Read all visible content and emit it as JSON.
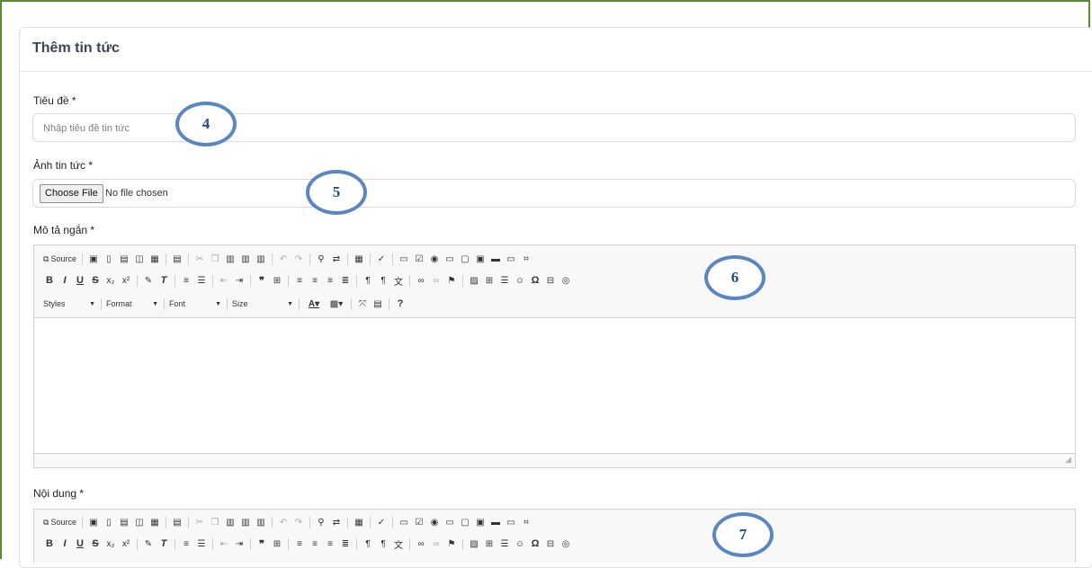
{
  "page": {
    "title": "Thêm tin tức"
  },
  "fields": {
    "title_label": "Tiêu đề *",
    "title_placeholder": "Nhập tiêu đề tin tức",
    "image_label": "Ảnh tin tức *",
    "choose_file_button": "Choose File",
    "no_file_text": "No file chosen",
    "short_desc_label": "Mô tả ngắn *",
    "content_label": "Nội dung *"
  },
  "toolbar": {
    "source": "Source",
    "styles": "Styles",
    "format": "Format",
    "font": "Font",
    "size": "Size",
    "help": "?"
  },
  "callouts": {
    "c4": "4",
    "c5": "5",
    "c6": "6",
    "c7": "7"
  },
  "colors": {
    "frame_border": "#5b8a3a",
    "callout_ring": "#5b86c2",
    "callout_text": "#1f4f8b"
  }
}
